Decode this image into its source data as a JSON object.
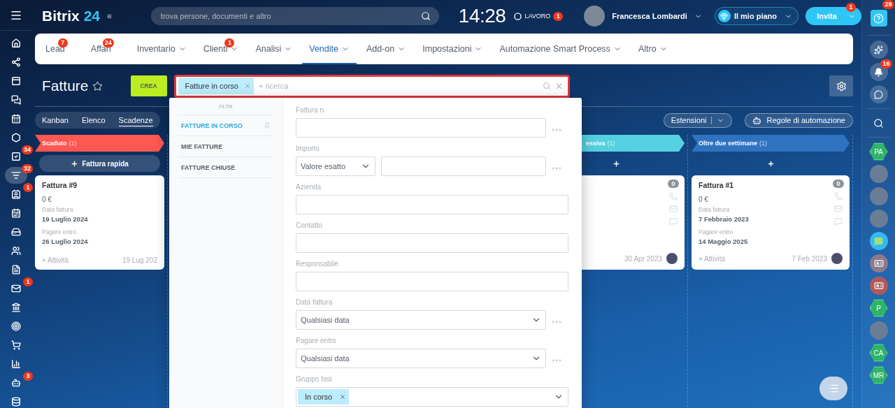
{
  "header": {
    "logo": "Bitrix",
    "logo_number": "24",
    "search": {
      "placeholder": "trova persone, documenti e altro"
    },
    "time": "14:28",
    "work_status": {
      "label": "LAVORO",
      "badge": "1"
    },
    "user": {
      "name": "Francesca Lombardi"
    },
    "plan_button": "Il mio piano",
    "invite_button": {
      "label": "Invita",
      "badge": "1"
    }
  },
  "left_sidebar": [
    {
      "kind": "home",
      "selected": false
    },
    {
      "kind": "network",
      "selected": false
    },
    {
      "kind": "window",
      "selected": false
    },
    {
      "kind": "chat",
      "selected": false
    },
    {
      "kind": "calendar",
      "selected": false
    },
    {
      "kind": "hexagon",
      "selected": false
    },
    {
      "kind": "task",
      "selected": false,
      "badge": "34"
    },
    {
      "kind": "funnel",
      "selected": true,
      "badge": "32"
    },
    {
      "kind": "contact",
      "selected": false,
      "badge": "1"
    },
    {
      "kind": "schedule",
      "selected": false
    },
    {
      "kind": "drive",
      "selected": false
    },
    {
      "kind": "people",
      "selected": false
    },
    {
      "kind": "document",
      "selected": false
    },
    {
      "kind": "mail",
      "selected": false,
      "badge": "1"
    },
    {
      "kind": "bank",
      "selected": false
    },
    {
      "kind": "target",
      "selected": false
    },
    {
      "kind": "cart",
      "selected": false
    },
    {
      "kind": "chart",
      "selected": false
    },
    {
      "kind": "robot",
      "selected": false,
      "badge": "3"
    },
    {
      "kind": "database",
      "selected": false
    }
  ],
  "nav_tabs": [
    {
      "label": "Lead",
      "badge": "7",
      "has_menu": false,
      "selected": false
    },
    {
      "label": "Affari",
      "badge": "24",
      "has_menu": false,
      "selected": false
    },
    {
      "label": "Inventario",
      "has_menu": true,
      "selected": false
    },
    {
      "label": "Clienti",
      "badge": "1",
      "has_menu": true,
      "selected": false
    },
    {
      "label": "Analisi",
      "has_menu": true,
      "selected": false
    },
    {
      "label": "Vendite",
      "has_menu": true,
      "selected": true
    },
    {
      "label": "Add-on",
      "has_menu": true,
      "selected": false
    },
    {
      "label": "Impostazioni",
      "has_menu": true,
      "selected": false
    },
    {
      "label": "Automazione Smart Process",
      "has_menu": true,
      "selected": false
    },
    {
      "label": "Altro",
      "has_menu": true,
      "selected": false
    }
  ],
  "page": {
    "title": "Fatture",
    "create_button": "CREA",
    "filter": {
      "chip": "Fatture in corso",
      "placeholder": "+ ricerca"
    },
    "views": [
      {
        "label": "Kanban",
        "selected": false
      },
      {
        "label": "Elenco",
        "selected": false
      },
      {
        "label": "Scadenze",
        "selected": true
      }
    ],
    "extensions_button": "Estensioni",
    "automation_button": "Regole di automazione"
  },
  "filter_popup": {
    "heading": "FILTRI",
    "presets": [
      {
        "label": "FATTURE IN CORSO",
        "selected": true,
        "pinned": true
      },
      {
        "label": "MIE FATTURE",
        "selected": false,
        "pinned": false
      },
      {
        "label": "FATTURE CHIUSE",
        "selected": false,
        "pinned": false
      }
    ],
    "fields": [
      {
        "label": "Fattura n.",
        "kind": "text"
      },
      {
        "label": "Importo",
        "kind": "range",
        "value": "Valore esatto"
      },
      {
        "label": "Azienda",
        "kind": "wide"
      },
      {
        "label": "Contatto",
        "kind": "wide"
      },
      {
        "label": "Responsabile",
        "kind": "wide"
      },
      {
        "label": "Data fattura",
        "kind": "select",
        "value": "Qualsiasi data"
      },
      {
        "label": "Pagare entro",
        "kind": "select",
        "value": "Qualsiasi data"
      },
      {
        "label": "Gruppo fasi",
        "kind": "chips",
        "chips": [
          "In corso"
        ]
      }
    ]
  },
  "kanban": [
    {
      "title": "Scaduto",
      "count": "(1)",
      "color": "#ff5752",
      "add_label": "Fattura rapida",
      "cards": [
        {
          "title": "Fattura #9",
          "amount": "0 €",
          "fields": [
            {
              "label": "Data fattura",
              "value": "19 Luglio 2024"
            },
            {
              "label": "Pagare entro",
              "value": "26 Luglio 2024"
            }
          ],
          "activity": "+ Attività",
          "date": "19 Lug 202"
        }
      ]
    },
    {
      "title": "essiva",
      "count": "(1)",
      "color": "#55d0e0",
      "cards": [
        {
          "counter": "0",
          "date": "30 Apr 2023"
        }
      ]
    },
    {
      "title": "Oltre due settimane",
      "count": "(1)",
      "color": "#2f72c0",
      "cards": [
        {
          "title": "Fattura #1",
          "amount": "0 €",
          "counter": "0",
          "fields": [
            {
              "label": "Data fattura",
              "value": "7 Febbraio 2023"
            },
            {
              "label": "Pagare entro",
              "value": "14 Maggio 2025"
            }
          ],
          "activity": "+ Attività",
          "date": "7 Feb 2023"
        }
      ]
    }
  ],
  "right_sidebar": {
    "help_badge": "29",
    "items": [
      {
        "kind": "copilot"
      },
      {
        "kind": "bell",
        "badge": "16"
      },
      {
        "kind": "chat"
      },
      {
        "kind": "search"
      },
      {
        "kind": "initials",
        "initials": "PA"
      },
      {
        "kind": "photo"
      },
      {
        "kind": "photo"
      },
      {
        "kind": "photo"
      },
      {
        "kind": "message"
      },
      {
        "kind": "contact"
      },
      {
        "kind": "contact"
      },
      {
        "kind": "initials",
        "initials": "P"
      },
      {
        "kind": "photo"
      },
      {
        "kind": "initials",
        "initials": "CA"
      },
      {
        "kind": "initials",
        "initials": "MR"
      }
    ]
  }
}
